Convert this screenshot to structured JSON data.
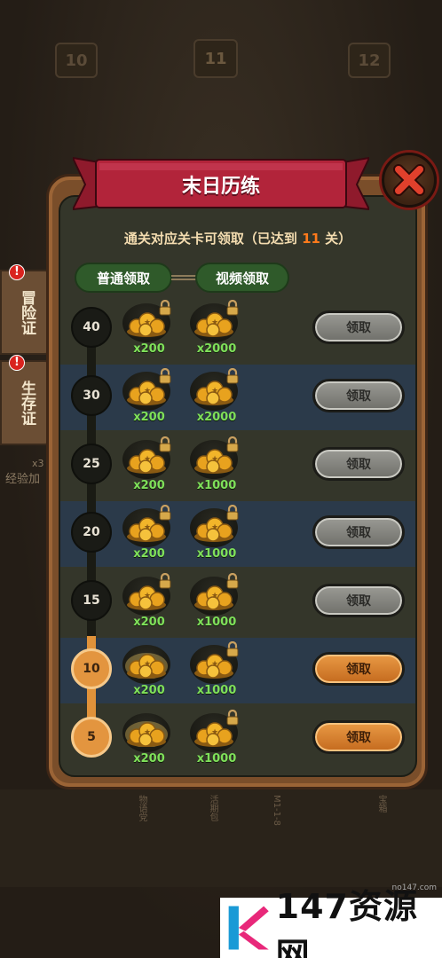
{
  "background": {
    "levels": [
      "10",
      "11",
      "12"
    ],
    "side_tabs": [
      {
        "label": "冒险证",
        "badge": "!"
      },
      {
        "label": "生存证",
        "badge": "!"
      }
    ],
    "exp_label": "经验加",
    "exp_multiplier": "x3",
    "bottom_labels": [
      "物语党",
      "活期包",
      "M1-1-8",
      "宝箱"
    ]
  },
  "panel": {
    "title": "末日历练",
    "subtitle_prefix": "通关对应关卡可领取（已达到",
    "subtitle_level": "11",
    "subtitle_suffix": "关）",
    "tabs": {
      "normal": "普通领取",
      "video": "视频领取"
    },
    "rows": [
      {
        "level": "40",
        "normal_qty": "x200",
        "video_qty": "x2000",
        "button": "领取",
        "unlocked": false
      },
      {
        "level": "30",
        "normal_qty": "x200",
        "video_qty": "x2000",
        "button": "领取",
        "unlocked": false
      },
      {
        "level": "25",
        "normal_qty": "x200",
        "video_qty": "x1000",
        "button": "领取",
        "unlocked": false
      },
      {
        "level": "20",
        "normal_qty": "x200",
        "video_qty": "x1000",
        "button": "领取",
        "unlocked": false
      },
      {
        "level": "15",
        "normal_qty": "x200",
        "video_qty": "x1000",
        "button": "领取",
        "unlocked": false
      },
      {
        "level": "10",
        "normal_qty": "x200",
        "video_qty": "x1000",
        "button": "领取",
        "unlocked": true
      },
      {
        "level": "5",
        "normal_qty": "x200",
        "video_qty": "x1000",
        "button": "领取",
        "unlocked": true
      }
    ],
    "colors": {
      "claim_active": "#d9812e",
      "claim_disabled": "#8a8a84",
      "quantity": "#7fe05a",
      "highlight": "#ff7a1c"
    }
  },
  "watermark": {
    "brand": "147资源网",
    "url": "no147.com"
  }
}
